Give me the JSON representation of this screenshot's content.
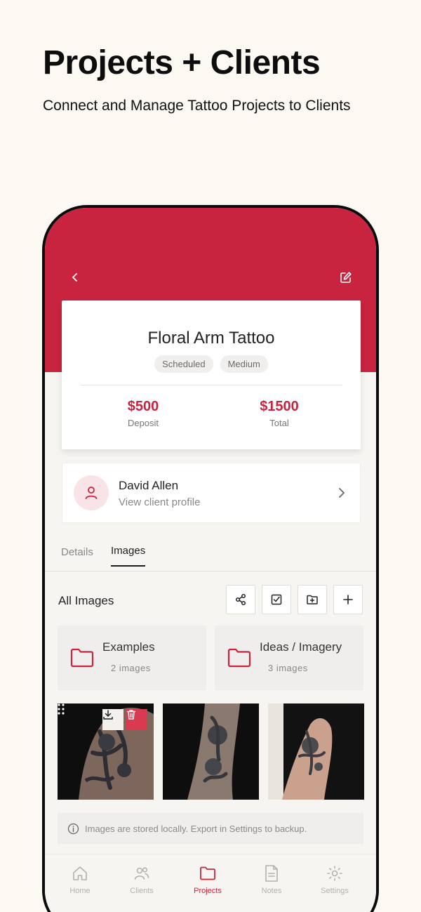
{
  "promo": {
    "headline": "Projects + Clients",
    "subheadline": "Connect and Manage Tattoo Projects to Clients"
  },
  "colors": {
    "accent": "#c8243f",
    "background": "#fcf8f2"
  },
  "header": {
    "back_icon": "chevron-left-icon",
    "edit_icon": "edit-icon"
  },
  "project": {
    "title": "Floral Arm Tattoo",
    "tags": [
      "Scheduled",
      "Medium"
    ],
    "deposit": {
      "value": "$500",
      "label": "Deposit"
    },
    "total": {
      "value": "$1500",
      "label": "Total"
    }
  },
  "client": {
    "name": "David Allen",
    "subtitle": "View client profile"
  },
  "tabs": [
    {
      "label": "Details",
      "active": false
    },
    {
      "label": "Images",
      "active": true
    }
  ],
  "images": {
    "heading": "All Images",
    "toolbar": [
      "share-icon",
      "select-icon",
      "new-folder-icon",
      "add-icon"
    ],
    "folders": [
      {
        "name": "Examples",
        "count": "2 images"
      },
      {
        "name": "Ideas / Imagery",
        "count": "3 images"
      }
    ],
    "info": "Images are stored locally. Export in Settings to backup."
  },
  "nav": [
    {
      "label": "Home",
      "icon": "home-icon",
      "active": false
    },
    {
      "label": "Clients",
      "icon": "clients-icon",
      "active": false
    },
    {
      "label": "Projects",
      "icon": "folder-icon",
      "active": true
    },
    {
      "label": "Notes",
      "icon": "notes-icon",
      "active": false
    },
    {
      "label": "Settings",
      "icon": "settings-icon",
      "active": false
    }
  ]
}
